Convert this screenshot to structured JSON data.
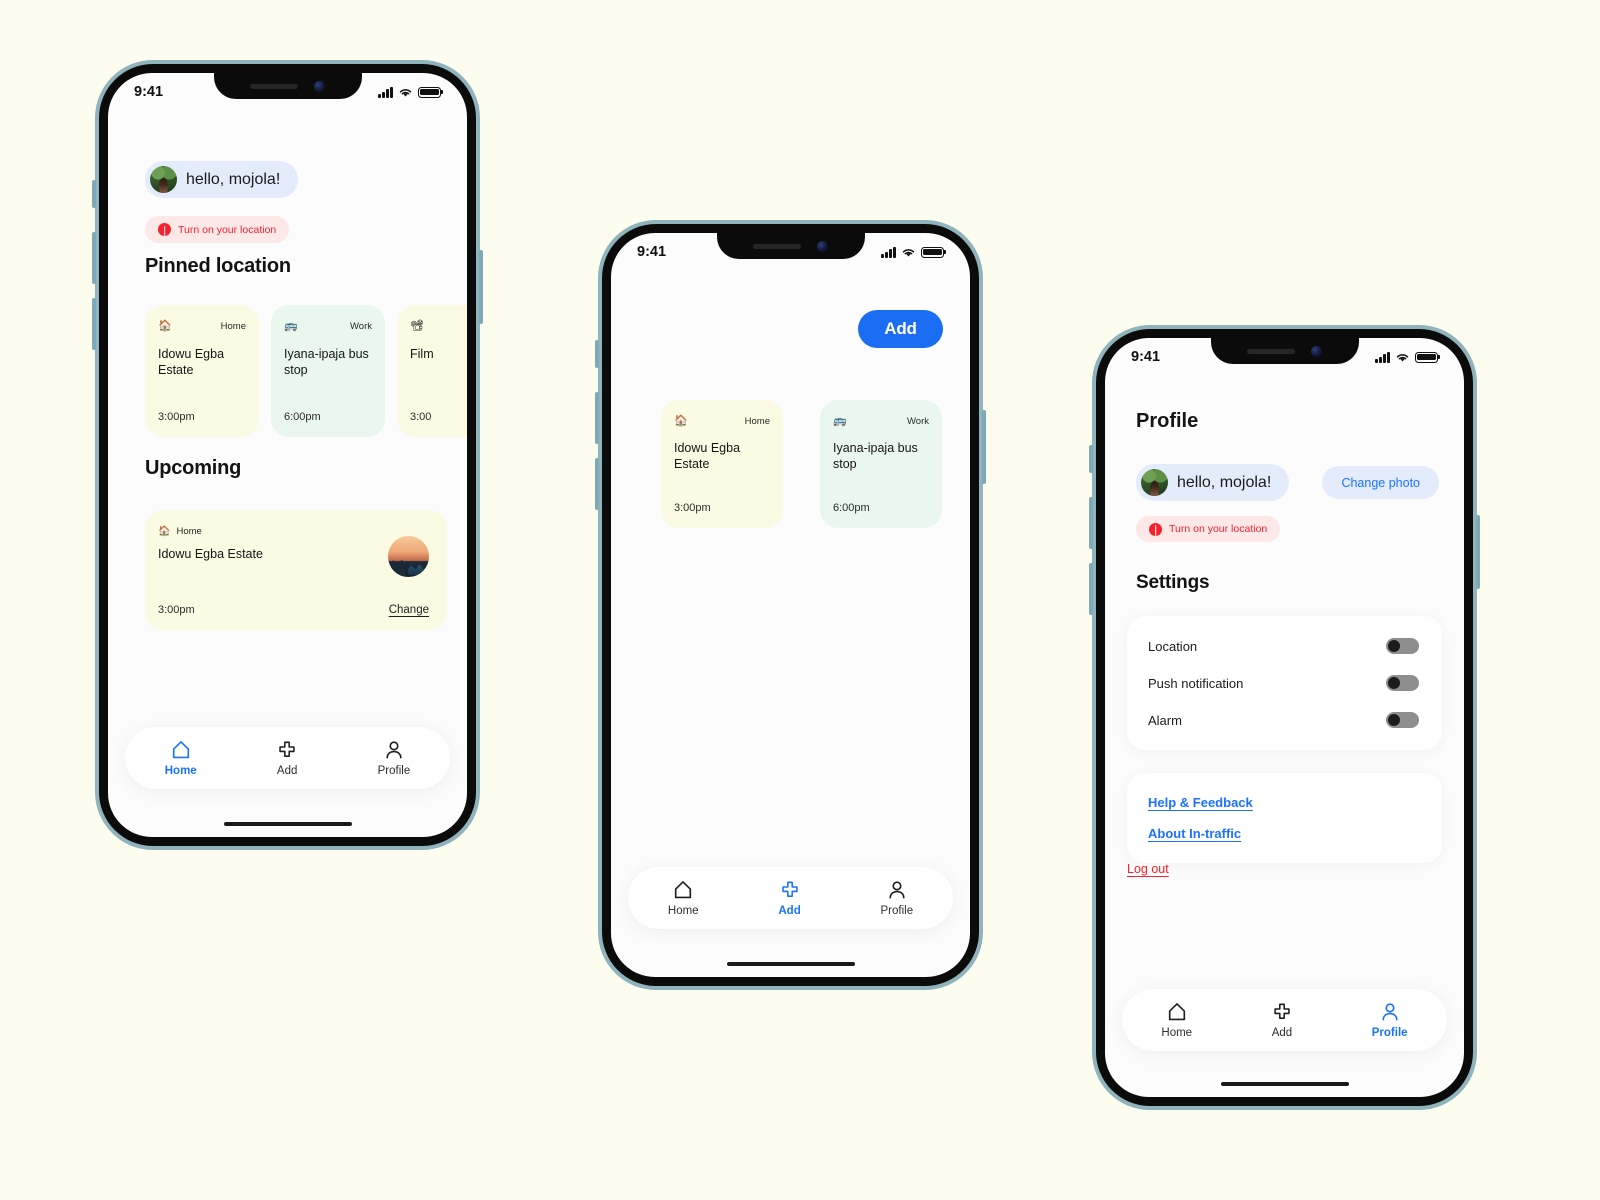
{
  "canvas": {
    "background": "#fdfdef"
  },
  "theme": {
    "accent": "#1a73ff",
    "accent_button": "#1b6ef3",
    "danger": "#f4212e",
    "card_yellow": "#fbfae3",
    "card_green": "#e9f7ef",
    "pill_blue": "#e4ecfb",
    "pill_red": "#fde8e8",
    "screen_bg": "#fcfcfc",
    "frame_rim": "#8fb4bd"
  },
  "status_bar": {
    "time": "9:41",
    "signal_icon": "cellular-signal-icon",
    "wifi_icon": "wifi-icon",
    "battery_icon": "battery-icon"
  },
  "nav": {
    "items": [
      {
        "label": "Home",
        "icon": "home-icon"
      },
      {
        "label": "Add",
        "icon": "plus-icon"
      },
      {
        "label": "Profile",
        "icon": "person-icon"
      }
    ]
  },
  "screens": [
    {
      "id": "home",
      "active_tab": "Home",
      "greeting": {
        "text": "hello, mojola!",
        "avatar": "user-avatar"
      },
      "location_warning": {
        "text": "Turn on your location",
        "icon": "alert-icon"
      },
      "pinned": {
        "title": "Pinned location",
        "cards": [
          {
            "emoji": "🏠",
            "icon_name": "house-emoji",
            "tag": "Home",
            "title": "Idowu Egba Estate",
            "time": "3:00pm",
            "color": "yellow"
          },
          {
            "emoji": "🚌",
            "icon_name": "bus-emoji",
            "tag": "Work",
            "title": "Iyana-ipaja bus stop",
            "time": "6:00pm",
            "color": "green"
          },
          {
            "emoji": "📽",
            "icon_name": "film-projector-emoji",
            "tag": "",
            "title": "Film",
            "time": "3:00",
            "color": "yellow"
          }
        ]
      },
      "upcoming": {
        "title": "Upcoming",
        "card": {
          "emoji": "🏠",
          "icon_name": "house-emoji",
          "tag": "Home",
          "title": "Idowu Egba Estate",
          "time": "3:00pm",
          "action": "Change",
          "thumbnail": "traffic-sunset-photo"
        }
      }
    },
    {
      "id": "add",
      "active_tab": "Add",
      "add_button": {
        "label": "Add"
      },
      "cards": [
        {
          "emoji": "🏠",
          "icon_name": "house-emoji",
          "tag": "Home",
          "title": "Idowu Egba Estate",
          "time": "3:00pm",
          "color": "yellow"
        },
        {
          "emoji": "🚌",
          "icon_name": "bus-emoji",
          "tag": "Work",
          "title": "Iyana-ipaja bus stop",
          "time": "6:00pm",
          "color": "green"
        }
      ]
    },
    {
      "id": "profile",
      "active_tab": "Profile",
      "page_title": "Profile",
      "greeting": {
        "text": "hello, mojola!",
        "avatar": "user-avatar"
      },
      "change_photo": {
        "label": "Change photo"
      },
      "location_warning": {
        "text": "Turn on your location",
        "icon": "alert-icon"
      },
      "settings": {
        "title": "Settings",
        "rows": [
          {
            "label": "Location",
            "on": false
          },
          {
            "label": "Push notification",
            "on": false
          },
          {
            "label": "Alarm",
            "on": false
          }
        ]
      },
      "links": [
        {
          "label": "Help & Feedback"
        },
        {
          "label": "About In-traffic"
        }
      ],
      "logout": {
        "label": "Log out"
      }
    }
  ]
}
